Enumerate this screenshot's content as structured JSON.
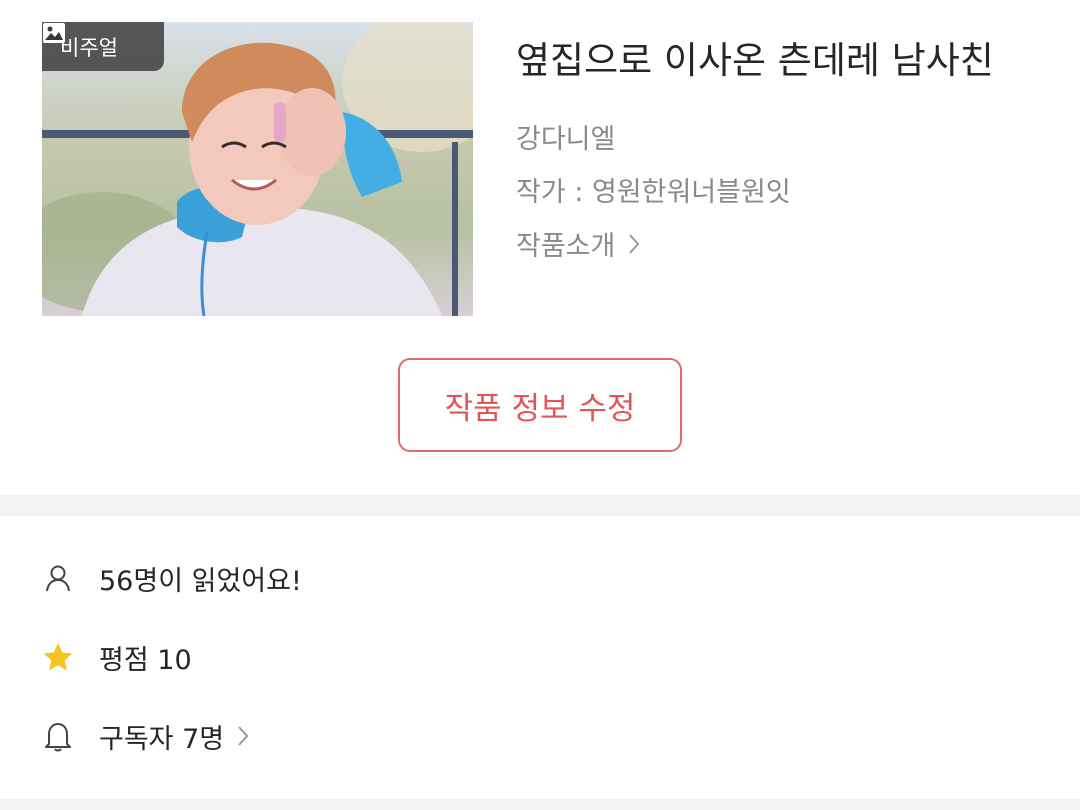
{
  "cover": {
    "badge_label": "비주얼",
    "badge_icon": "image-icon",
    "image_subject": "photo"
  },
  "work": {
    "title": "옆집으로 이사온 츤데레 남사친",
    "artist": "강다니엘",
    "author": "작가 : 영원한워너블원잇",
    "intro_label": "작품소개"
  },
  "actions": {
    "edit_label": "작품 정보 수정"
  },
  "stats": {
    "readers": "56명이 읽었어요!",
    "rating": "평점 10",
    "subscribers": "구독자 7명"
  },
  "colors": {
    "accent_red": "#e05757",
    "star_yellow": "#f7c422",
    "muted_text": "#8a8a8a",
    "band_gray": "#f1f2f4"
  }
}
